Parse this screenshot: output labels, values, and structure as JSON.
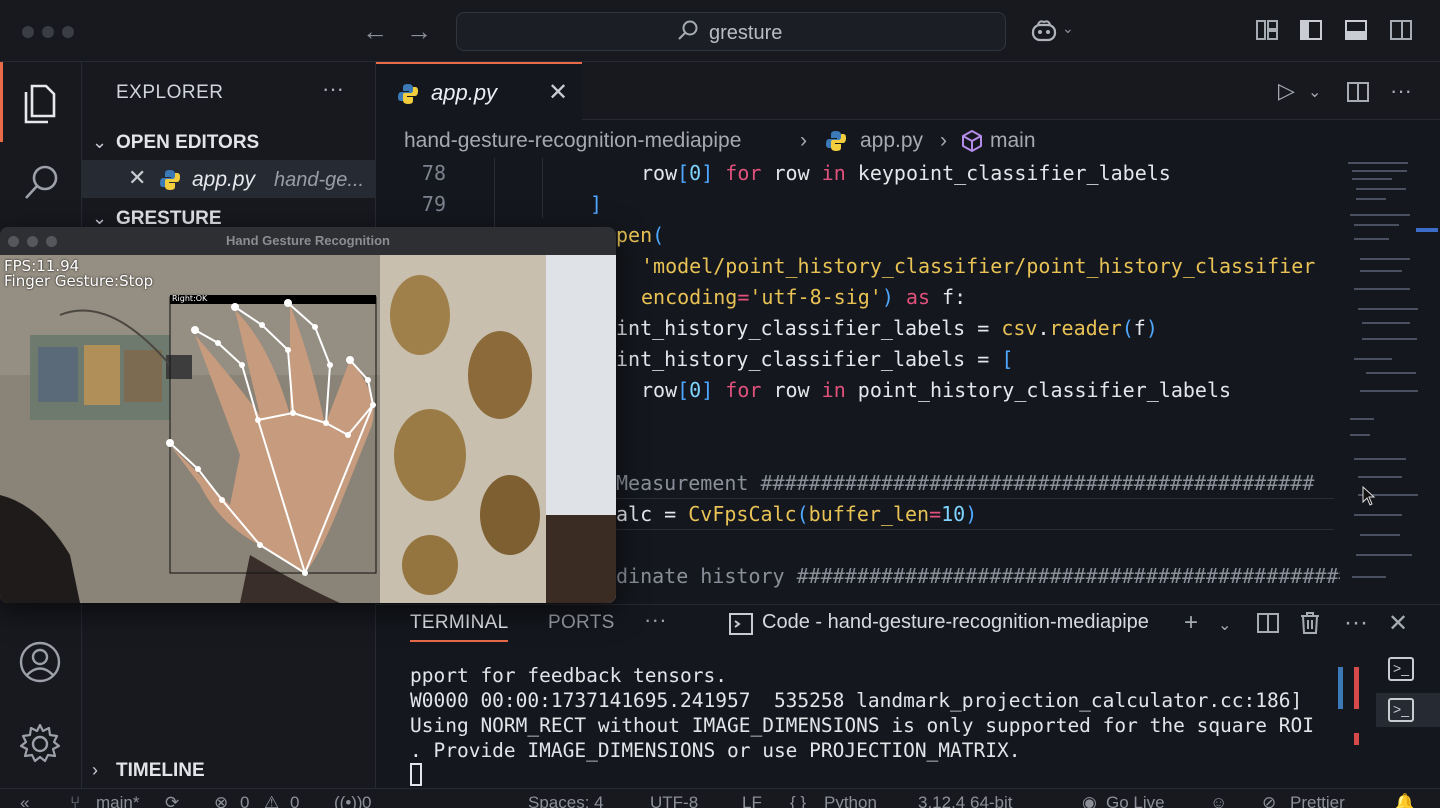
{
  "titlebar": {
    "search_text": "gresture"
  },
  "sidebar": {
    "title": "EXPLORER",
    "more": "···",
    "open_editors_label": "OPEN EDITORS",
    "open_file": {
      "name": "app.py",
      "dir": "hand-ge..."
    },
    "workspace_label": "GRESTURE",
    "timeline_label": "TIMELINE"
  },
  "editor": {
    "tab": {
      "name": "app.py",
      "close": "✕"
    },
    "breadcrumbs": {
      "folder": "hand-gesture-recognition-mediapipe",
      "file": "app.py",
      "symbol": "main",
      "sep": "›"
    },
    "line_numbers": [
      "78",
      "79"
    ],
    "code": {
      "l78_a": "row",
      "l78_b": "[",
      "l78_c": "0",
      "l78_d": "]",
      "l78_e": " for ",
      "l78_f": "row",
      "l78_g": " in ",
      "l78_h": "keypoint_classifier_labels",
      "l79": "]",
      "l80_a": "pen",
      "l80_b": "(",
      "l81": "'model/point_history_classifier/point_history_classifier",
      "l82_a": "encoding",
      "l82_b": "=",
      "l82_c": "'utf-8-sig'",
      "l82_d": ")",
      "l82_e": " as ",
      "l82_f": "f:",
      "l83_a": "int_history_classifier_labels = ",
      "l83_b": "csv",
      "l83_c": ".",
      "l83_d": "reader",
      "l83_e": "(",
      "l83_f": "f",
      "l83_g": ")",
      "l84_a": "int_history_classifier_labels = ",
      "l84_b": "[",
      "l85_a": "row",
      "l85_b": "[",
      "l85_c": "0",
      "l85_d": "]",
      "l85_e": " for ",
      "l85_f": "row",
      "l85_g": " in ",
      "l85_h": "point_history_classifier_labels",
      "l88_a": "Measurement ",
      "l88_b": "##############################################",
      "l89_a": "alc = ",
      "l89_b": "CvFpsCalc",
      "l89_c": "(",
      "l89_d": "buffer_len",
      "l89_e": "=",
      "l89_f": "10",
      "l89_g": ")",
      "l91_a": "dinate history ",
      "l91_b": "##############################################"
    }
  },
  "panel": {
    "tabs": [
      "TERMINAL",
      "PORTS"
    ],
    "more": "···",
    "terminal_name": "Code - hand-gesture-recognition-mediapipe",
    "lines": [
      "pport for feedback tensors.",
      "W0000 00:00:1737141695.241957  535258 landmark_projection_calculator.cc:186]",
      "Using NORM_RECT without IMAGE_DIMENSIONS is only supported for the square ROI",
      ". Provide IMAGE_DIMENSIONS or use PROJECTION_MATRIX."
    ]
  },
  "statusbar": {
    "branch": "main*",
    "errors": "0",
    "warnings": "0",
    "ports": "0",
    "spaces": "Spaces: 4",
    "encoding": "UTF-8",
    "eol": "LF",
    "language": "Python",
    "interpreter": "3.12.4 64-bit",
    "golive": "Go Live",
    "prettier": "Prettier"
  },
  "camera_window": {
    "title": "Hand Gesture Recognition",
    "fps": "FPS:11.94",
    "gesture": "Finger Gesture:Stop",
    "hand_label": "Right:OK"
  },
  "colors": {
    "accent": "#e86a48",
    "keyword": "#e0517c",
    "string": "#e8c255",
    "number": "#7fd3ff"
  }
}
